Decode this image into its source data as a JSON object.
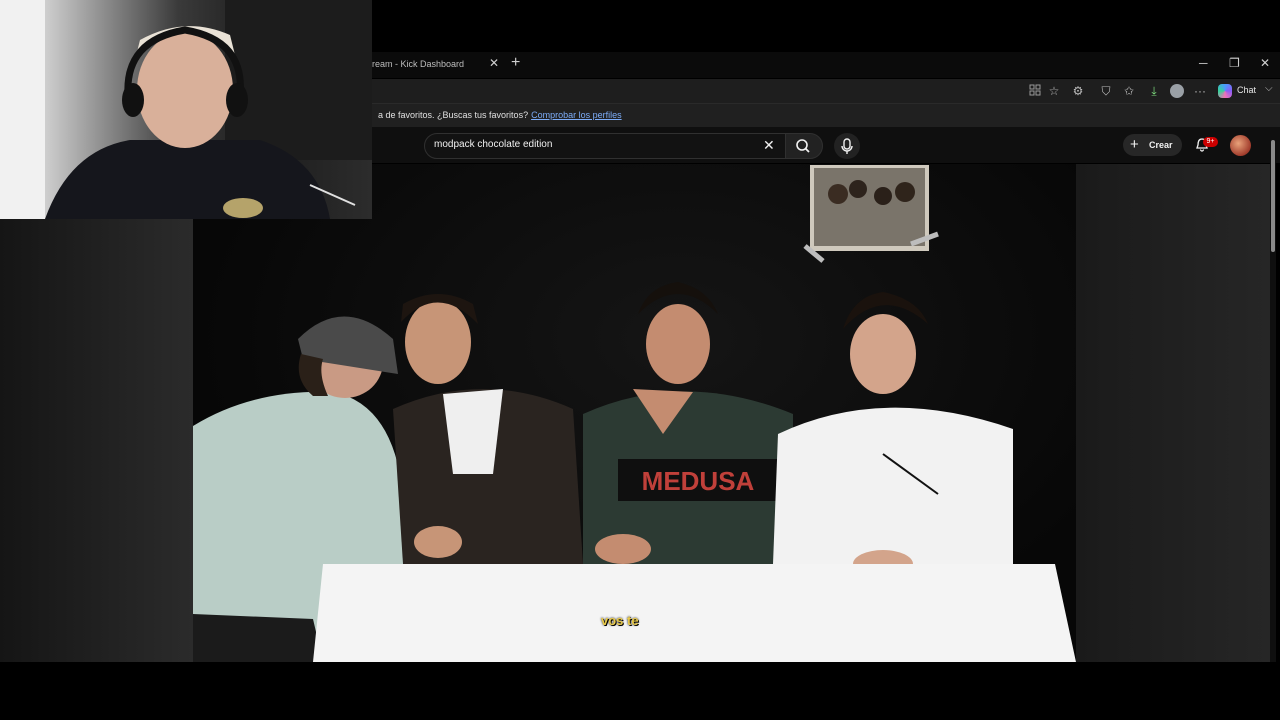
{
  "browser": {
    "tab_title": "ream - Kick Dashboard",
    "tab_close": "✕",
    "new_tab": "+",
    "window_controls": {
      "minimize": "─",
      "restore": "❐",
      "close": "✕"
    },
    "toolbar_icons": [
      "grid-icon",
      "star-icon",
      "extension-icon",
      "shield-icon",
      "favorites-icon",
      "download-icon",
      "profile-icon",
      "more-icon"
    ],
    "more_label": "···",
    "chat_label": "Chat",
    "chat_chevron": "⌵"
  },
  "favorites_bar": {
    "text": "a de favoritos. ¿Buscas tus favoritos?",
    "link": "Comprobar los perfiles"
  },
  "youtube": {
    "search_value": "modpack chocolate edition",
    "clear_glyph": "✕",
    "create_plus": "+",
    "create_label": "Crear",
    "notification_badge": "9+"
  },
  "video": {
    "subtitle": "vos te",
    "shirt_text": "MEDUSA"
  }
}
